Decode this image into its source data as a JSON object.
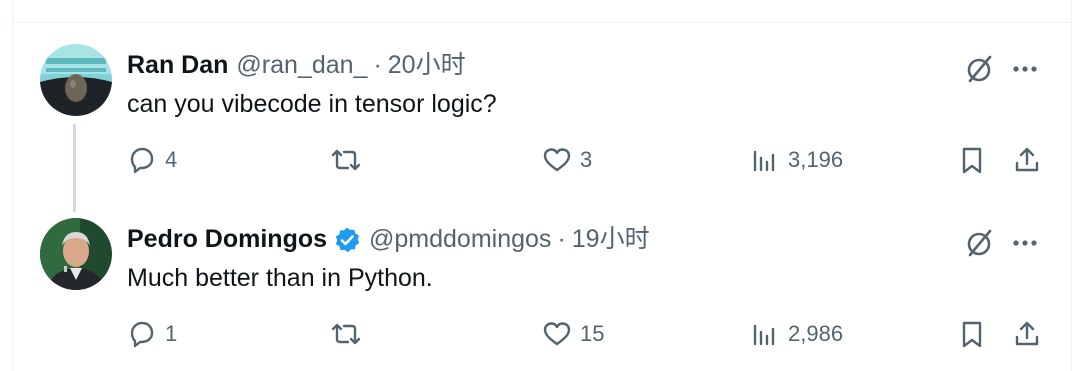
{
  "tweets": [
    {
      "author": {
        "name": "Ran Dan",
        "handle": "@ran_dan_",
        "verified": false
      },
      "time": "20小时",
      "text": "can you vibecode in tensor logic?",
      "stats": {
        "replies": "4",
        "retweets": "",
        "likes": "3",
        "views": "3,196"
      }
    },
    {
      "author": {
        "name": "Pedro Domingos",
        "handle": "@pmddomingos",
        "verified": true
      },
      "time": "19小时",
      "text": "Much better than in Python.",
      "stats": {
        "replies": "1",
        "retweets": "",
        "likes": "15",
        "views": "2,986"
      }
    }
  ],
  "separator": "·",
  "colors": {
    "text": "#0f1419",
    "secondary": "#536471",
    "verified": "#1d9bf0",
    "thread_line": "#cfd9de"
  },
  "icons": [
    "grok-icon",
    "more-icon",
    "reply-icon",
    "retweet-icon",
    "like-icon",
    "views-icon",
    "bookmark-icon",
    "share-icon",
    "verified-badge-icon"
  ]
}
